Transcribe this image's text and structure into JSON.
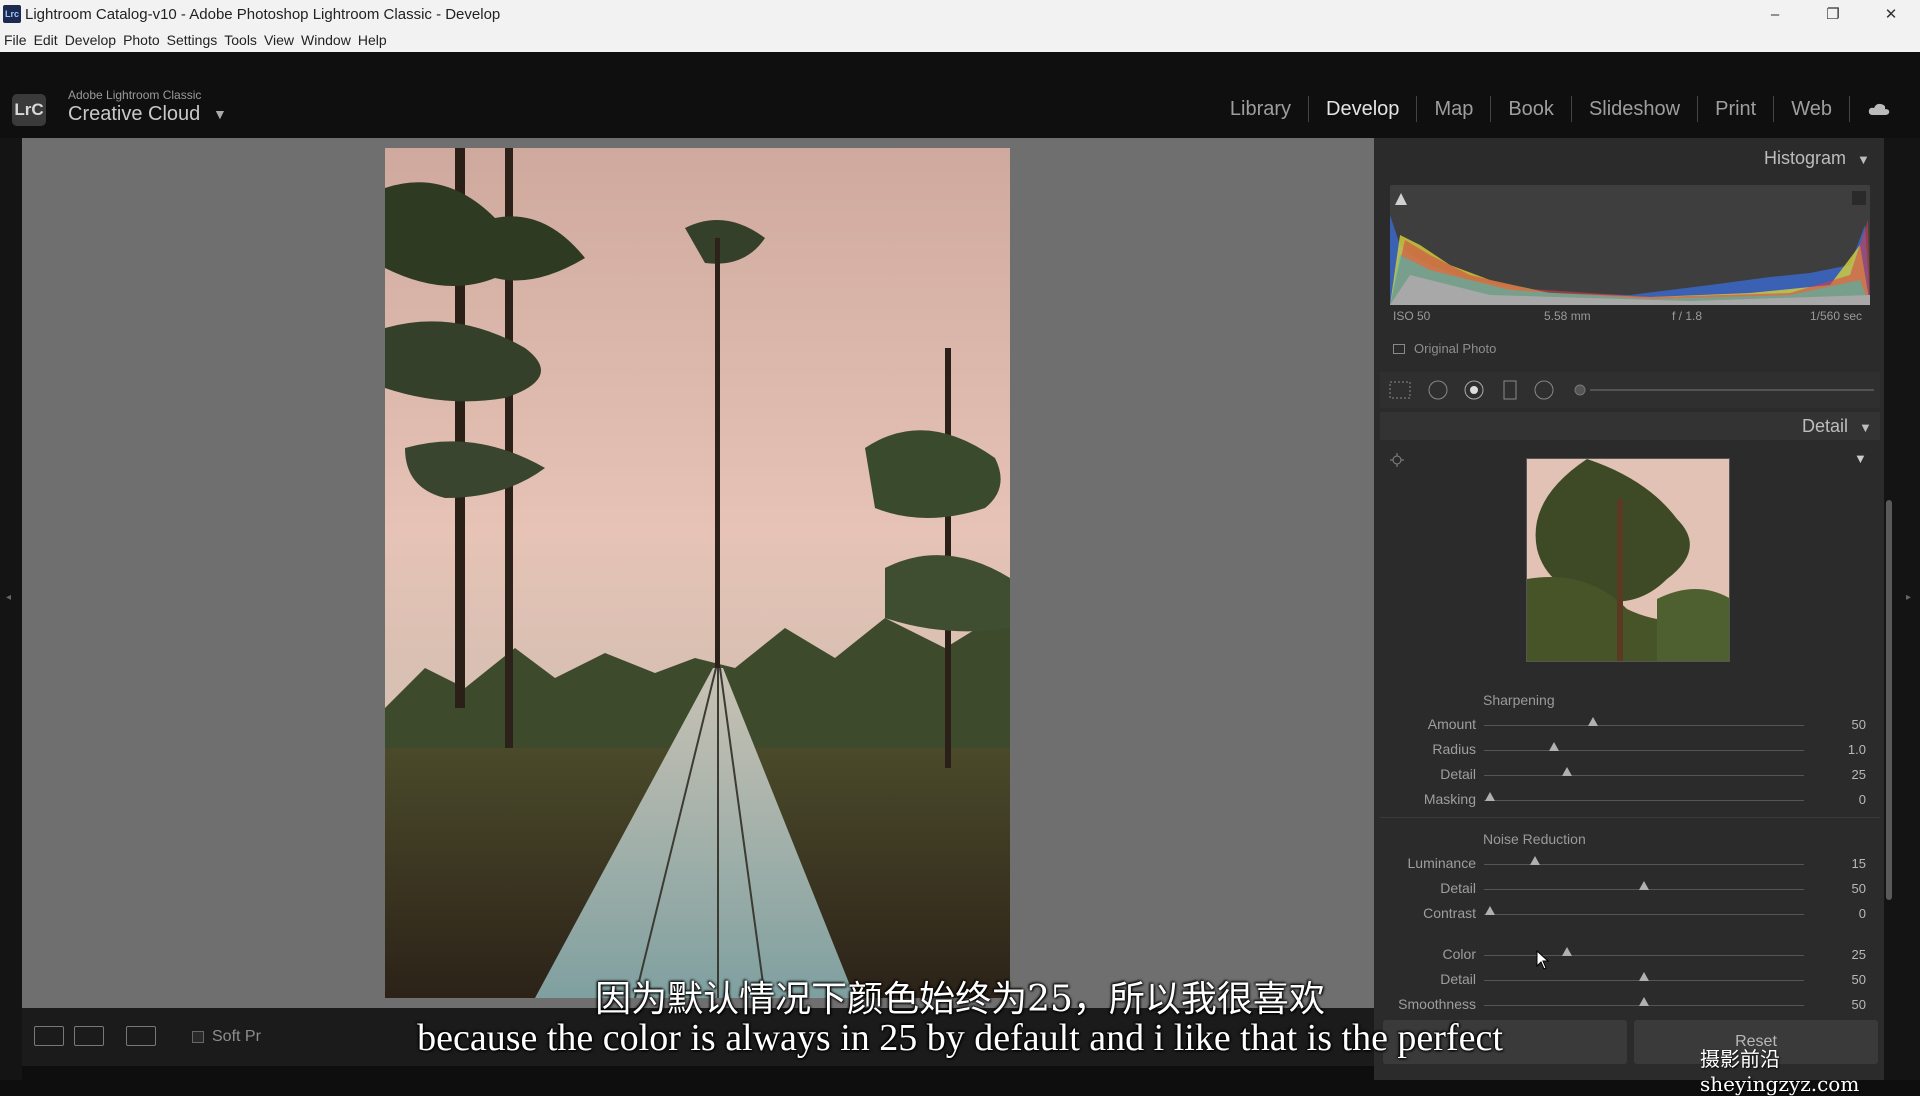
{
  "window": {
    "title": "Lightroom Catalog-v10 - Adobe Photoshop Lightroom Classic - Develop",
    "app_icon": "Lrc",
    "controls": [
      "–",
      "❐",
      "✕"
    ]
  },
  "menu": [
    "File",
    "Edit",
    "Develop",
    "Photo",
    "Settings",
    "Tools",
    "View",
    "Window",
    "Help"
  ],
  "header": {
    "badge": "LrC",
    "brand_small": "Adobe Lightroom Classic",
    "brand_large": "Creative Cloud",
    "caret": "▼",
    "modules": [
      "Library",
      "Develop",
      "Map",
      "Book",
      "Slideshow",
      "Print",
      "Web"
    ],
    "active_module": "Develop"
  },
  "toolbar": {
    "soft_proof_label": "Soft Pr"
  },
  "histogram": {
    "title": "Histogram",
    "caret": "▼",
    "iso": "ISO 50",
    "focal": "5.58 mm",
    "aperture": "f / 1.8",
    "shutter": "1/560 sec",
    "original_photo_label": "Original Photo"
  },
  "detail": {
    "title": "Detail",
    "caret": "▼",
    "sharpening": {
      "label": "Sharpening",
      "rows": [
        {
          "label": "Amount",
          "value": "50",
          "fraction": 0.34
        },
        {
          "label": "Radius",
          "value": "1.0",
          "fraction": 0.22
        },
        {
          "label": "Detail",
          "value": "25",
          "fraction": 0.26
        },
        {
          "label": "Masking",
          "value": "0",
          "fraction": 0.02
        }
      ]
    },
    "noise_reduction": {
      "label": "Noise Reduction",
      "rows": [
        {
          "label": "Luminance",
          "value": "15",
          "fraction": 0.16
        },
        {
          "label": "Detail",
          "value": "50",
          "fraction": 0.5
        },
        {
          "label": "Contrast",
          "value": "0",
          "fraction": 0.02
        },
        {
          "label": "Color",
          "value": "25",
          "fraction": 0.26
        },
        {
          "label": "Detail",
          "value": "50",
          "fraction": 0.5
        },
        {
          "label": "Smoothness",
          "value": "50",
          "fraction": 0.5
        }
      ]
    },
    "reset_label": "Reset"
  },
  "subtitles": {
    "cn": "因为默认情况下颜色始终为25，所以我很喜欢",
    "en": "because the color is always in 25 by default and i like that is the perfect"
  },
  "watermark": "摄影前沿 sheyingzyz.com"
}
